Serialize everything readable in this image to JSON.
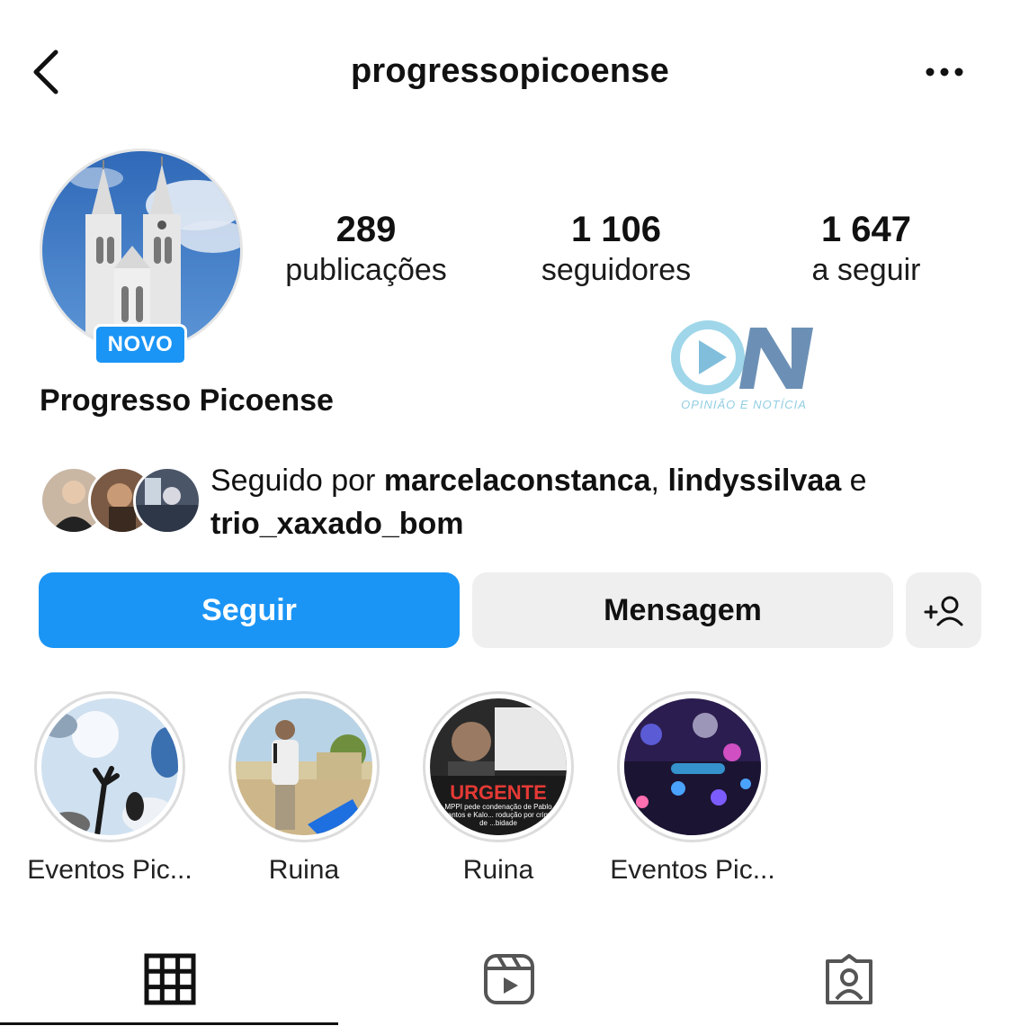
{
  "header": {
    "username": "progressopicoense",
    "back_icon": "chevron-left-icon",
    "more_icon": "more-horizontal-icon"
  },
  "profile": {
    "badge": "NOVO",
    "display_name": "Progresso Picoense",
    "stats": [
      {
        "value": "289",
        "label": "publicações"
      },
      {
        "value": "1 106",
        "label": "seguidores"
      },
      {
        "value": "1 647",
        "label": "a seguir"
      }
    ]
  },
  "watermark": {
    "text": "OPINIÃO E NOTÍCIA"
  },
  "followed_by": {
    "prefix": "Seguido por ",
    "user1": "marcelaconstanca",
    "sep": ", ",
    "user2": "lindyssilvaa",
    "conj": " e",
    "user3": "trio_xaxado_bom"
  },
  "actions": {
    "follow_label": "Seguir",
    "message_label": "Mensagem",
    "add_icon": "add-person-icon"
  },
  "highlights": [
    {
      "label": "Eventos Pic..."
    },
    {
      "label": "Ruina"
    },
    {
      "label": "Ruina",
      "overlay": "URGENTE",
      "caption": "MPPI pede condenação de Pablo Santos e Kalo... rodução por crime de ...bidade"
    },
    {
      "label": "Eventos Pic..."
    }
  ],
  "tabs": [
    {
      "icon": "grid-icon",
      "active": true
    },
    {
      "icon": "reels-icon",
      "active": false
    },
    {
      "icon": "tagged-icon",
      "active": false
    }
  ],
  "colors": {
    "primary": "#1b95f5",
    "secondary_button": "#efefef",
    "text": "#111111"
  }
}
